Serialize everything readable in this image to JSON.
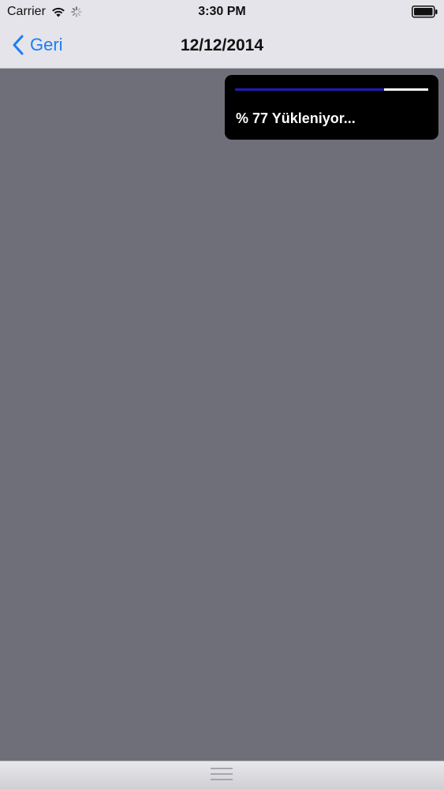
{
  "status_bar": {
    "carrier": "Carrier",
    "time": "3:30 PM",
    "icons": [
      "wifi-icon",
      "activity-spinner-icon",
      "battery-icon"
    ]
  },
  "nav_bar": {
    "back_label": "Geri",
    "title": "12/12/2014"
  },
  "loading_hud": {
    "text": "% 77 Yükleniyor...",
    "progress": 0.77,
    "fill_color": "#1d1db8",
    "track_color": "#ffffff"
  },
  "colors": {
    "accent": "#1a7ef5",
    "content_background": "#6e6f78",
    "hud_background": "#000000"
  }
}
